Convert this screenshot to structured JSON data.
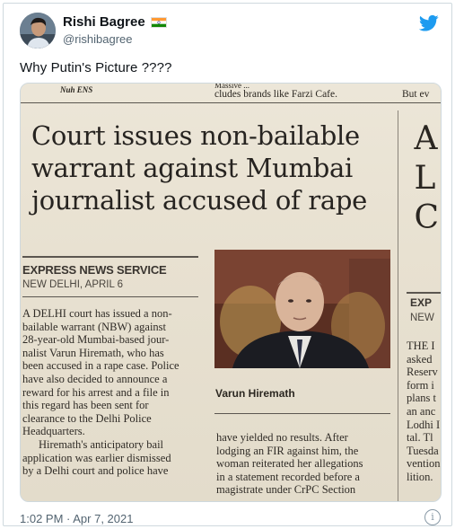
{
  "tweet": {
    "display_name": "Rishi Bagree",
    "handle": "@rishibagree",
    "text": "Why Putin's Picture ????",
    "timestamp": "1:02 PM · Apr 7, 2021",
    "avatar_icon": "user-avatar",
    "verified_flag_icon": "india-flag-icon",
    "platform_icon": "twitter-bird-icon",
    "info_icon": "info-icon",
    "accent_color": "#1d9bf0"
  },
  "newspaper": {
    "top_left": "Nuh ENS",
    "top_mid_1": "Massive ...",
    "top_mid_2": "cludes brands like Farzi Cafe.",
    "top_right": "But ev",
    "headline_1": "Court issues non-bailable",
    "headline_2": "warrant against Mumbai",
    "headline_3": "journalist accused of rape",
    "right_letters": [
      "A",
      "L",
      "C"
    ],
    "byline": "EXPRESS NEWS SERVICE",
    "dateline": "NEW DELHI, APRIL 6",
    "col1": [
      "A DELHI court has issued a non-",
      "bailable warrant (NBW) against",
      "28-year-old Mumbai-based jour-",
      "nalist Varun Hiremath, who has",
      "been accused in a rape case. Police",
      "have also decided to announce a",
      "reward for his arrest and a file in",
      "this regard has been sent for",
      "clearance to the Delhi Police",
      "Headquarters.",
      "Hiremath's anticipatory bail",
      "application was earlier dismissed",
      "by a Delhi court and police have"
    ],
    "caption": "Varun Hiremath",
    "col2": [
      "have yielded no results. After",
      "lodging an FIR against him, the",
      "woman reiterated her allegations",
      "in a statement recorded before a",
      "magistrate under CrPC Section"
    ],
    "right_byline": "EXP",
    "right_dateline": "NEW",
    "col3": [
      "THE I",
      "asked",
      "Reserv",
      "form i",
      "plans t",
      "an anc",
      "Lodhi I",
      "tal. Tl",
      "Tuesda",
      "vention",
      "lition."
    ]
  }
}
